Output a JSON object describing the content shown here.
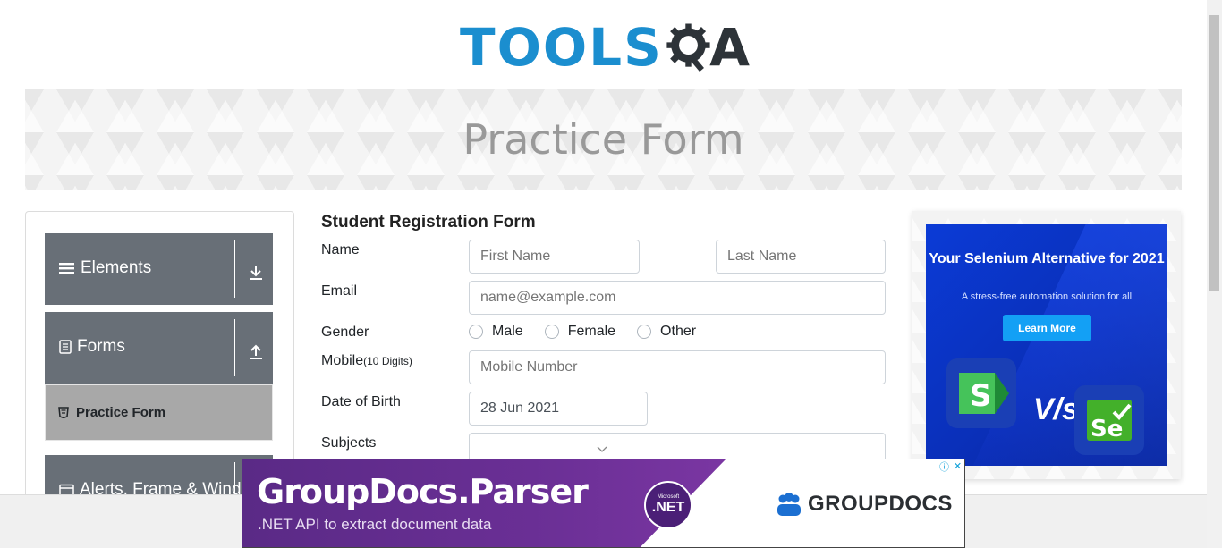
{
  "header": {
    "logo_text": "TOOLS",
    "logo_suffix": "A"
  },
  "banner": {
    "title": "Practice Form"
  },
  "sidebar": {
    "groups": [
      {
        "label": "Elements"
      },
      {
        "label": "Forms"
      },
      {
        "label": "Alerts, Frame & Windows"
      }
    ],
    "active_item": "Practice Form"
  },
  "form": {
    "title": "Student Registration Form",
    "name_label": "Name",
    "first_name_placeholder": "First Name",
    "last_name_placeholder": "Last Name",
    "email_label": "Email",
    "email_placeholder": "name@example.com",
    "gender_label": "Gender",
    "gender_options": [
      "Male",
      "Female",
      "Other"
    ],
    "mobile_label": "Mobile",
    "mobile_hint": "(10 Digits)",
    "mobile_placeholder": "Mobile Number",
    "dob_label": "Date of Birth",
    "dob_value": "28 Jun 2021",
    "subjects_label": "Subjects"
  },
  "right_ad": {
    "headline": "Your Selenium Alternative for 2021",
    "subtext": "A stress-free automation solution for all",
    "button": "Learn More",
    "vs": "V/s",
    "left_tile": "S",
    "right_tile": "Se"
  },
  "bottom_ad": {
    "title": "GroupDocs.Parser",
    "tagline": ".NET API to extract document data",
    "badge_small": "Microsoft",
    "badge": ".NET",
    "brand": "GROUPDOCS"
  },
  "colors": {
    "brand_blue": "#1b8ecf",
    "sidebar_group": "#686f77",
    "active_item": "#a8a8a8"
  }
}
